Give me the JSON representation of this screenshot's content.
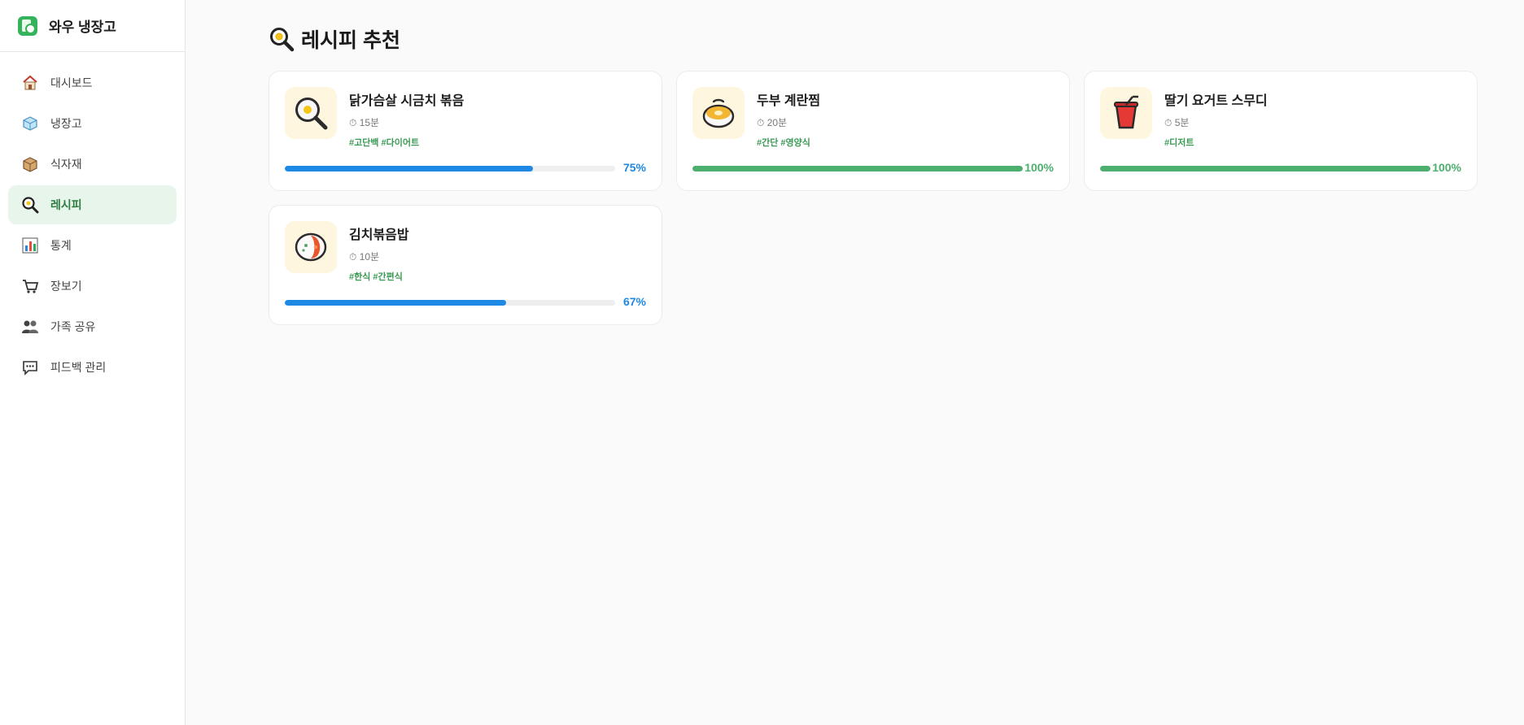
{
  "app": {
    "title": "와우 냉장고",
    "logo_icon": "fridge-check-icon"
  },
  "sidebar": {
    "items": [
      {
        "label": "대시보드",
        "icon": "house-icon",
        "active": false
      },
      {
        "label": "냉장고",
        "icon": "ice-cube-icon",
        "active": false
      },
      {
        "label": "식자재",
        "icon": "box-icon",
        "active": false
      },
      {
        "label": "레시피",
        "icon": "magnifier-icon",
        "active": true
      },
      {
        "label": "통계",
        "icon": "bar-chart-icon",
        "active": false
      },
      {
        "label": "장보기",
        "icon": "cart-icon",
        "active": false
      },
      {
        "label": "가족 공유",
        "icon": "people-icon",
        "active": false
      },
      {
        "label": "피드백 관리",
        "icon": "chat-bubble-icon",
        "active": false
      }
    ]
  },
  "page": {
    "title": "레시피 추천",
    "title_icon": "magnifier-icon"
  },
  "colors": {
    "accent": "#2e7d43",
    "active_bg": "#e8f5ea",
    "tag": "#3a9a55",
    "progress_partial": "#1e88e5",
    "progress_full": "#4caf6e",
    "thumb_bg": "#fff6df"
  },
  "recipes": [
    {
      "name": "닭가슴살 시금치 볶음",
      "time": "⏱ 15분",
      "tags": "#고단백 #다이어트",
      "match": 0.75,
      "match_label": "75%",
      "icon": "frying-pan-icon"
    },
    {
      "name": "두부 계란찜",
      "time": "⏱ 20분",
      "tags": "#간단 #영양식",
      "match": 1.0,
      "match_label": "100%",
      "icon": "stew-pot-icon"
    },
    {
      "name": "딸기 요거트 스무디",
      "time": "⏱ 5분",
      "tags": "#디저트",
      "match": 1.0,
      "match_label": "100%",
      "icon": "cup-with-straw-icon"
    },
    {
      "name": "김치볶음밥",
      "time": "⏱ 10분",
      "tags": "#한식 #간편식",
      "match": 0.67,
      "match_label": "67%",
      "icon": "rice-bowl-icon"
    }
  ]
}
